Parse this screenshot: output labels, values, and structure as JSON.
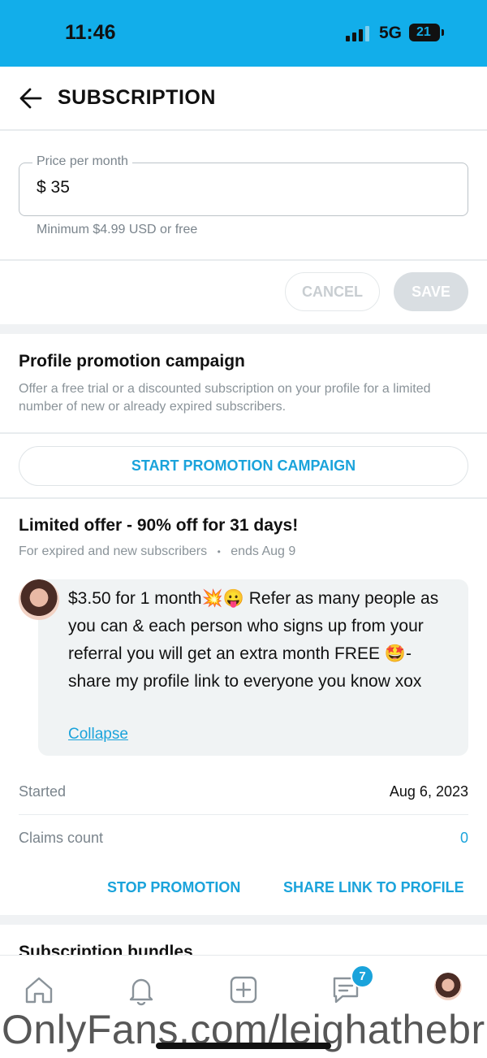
{
  "status_bar": {
    "time": "11:46",
    "network": "5G",
    "battery": "21"
  },
  "header": {
    "title": "SUBSCRIPTION"
  },
  "price": {
    "label": "Price per month",
    "value": "$ 35",
    "hint": "Minimum $4.99 USD or free"
  },
  "price_actions": {
    "cancel": "CANCEL",
    "save": "SAVE"
  },
  "promotion": {
    "title": "Profile promotion campaign",
    "description": "Offer a free trial or a discounted subscription on your profile for a limited number of new or already expired subscribers.",
    "start_button": "START PROMOTION CAMPAIGN"
  },
  "offer": {
    "title": "Limited offer - 90% off for 31 days!",
    "audience": "For expired and new subscribers",
    "separator": "•",
    "ends": "ends Aug 9",
    "message": "$3.50 for 1 month💥😛 Refer as many people as you can & each person who signs up from your referral you will get an extra month FREE 🤩- share my profile link to everyone you know xox",
    "collapse": "Collapse",
    "started_label": "Started",
    "started_value": "Aug 6, 2023",
    "claims_label": "Claims count",
    "claims_value": "0",
    "stop_button": "STOP PROMOTION",
    "share_button": "SHARE LINK TO PROFILE"
  },
  "bundles": {
    "title": "Subscription bundles"
  },
  "nav": {
    "messages_badge": "7",
    "icons": [
      "home-icon",
      "bell-icon",
      "add-post-icon",
      "messages-icon",
      "profile-avatar"
    ]
  },
  "watermark": "OnlyFans.com/leighathebr",
  "colors": {
    "status_bar": "#12aeea",
    "accent": "#1aa3db"
  }
}
